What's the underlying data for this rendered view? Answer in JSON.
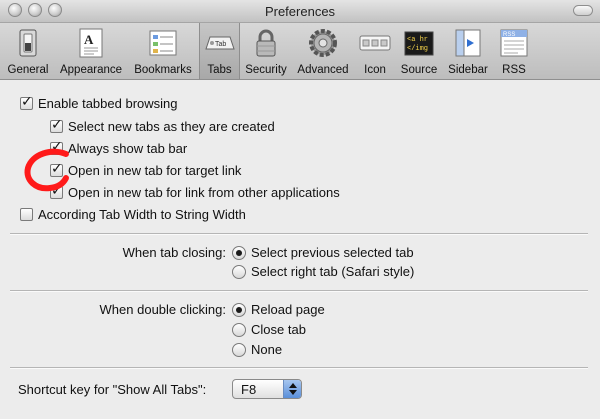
{
  "window": {
    "title": "Preferences"
  },
  "toolbar": {
    "items": [
      {
        "label": "General",
        "icon": "switch-icon"
      },
      {
        "label": "Appearance",
        "icon": "font-icon"
      },
      {
        "label": "Bookmarks",
        "icon": "bookmarks-icon"
      },
      {
        "label": "Tabs",
        "icon": "tab-icon",
        "selected": true
      },
      {
        "label": "Security",
        "icon": "lock-icon"
      },
      {
        "label": "Advanced",
        "icon": "gear-icon"
      },
      {
        "label": "Icon",
        "icon": "icon-bar-icon"
      },
      {
        "label": "Source",
        "icon": "source-icon"
      },
      {
        "label": "Sidebar",
        "icon": "sidebar-icon"
      },
      {
        "label": "RSS",
        "icon": "rss-icon"
      }
    ],
    "tab_icon_text": "Tab",
    "source_icon_text": [
      "<a hr",
      "</img"
    ],
    "rss_icon_text": "RSS"
  },
  "options": {
    "enable_tabbed": {
      "label": "Enable tabbed browsing",
      "checked": true
    },
    "select_new_tabs": {
      "label": "Select new tabs as they are created",
      "checked": true
    },
    "always_show_tab_bar": {
      "label": "Always show tab bar",
      "checked": true
    },
    "open_target_link": {
      "label": "Open in new tab for target link",
      "checked": true
    },
    "open_other_apps": {
      "label": "Open in new tab for link from other applications",
      "checked": true
    },
    "according_tab_width": {
      "label": "According Tab Width to String Width",
      "checked": false
    }
  },
  "tab_closing": {
    "label": "When tab closing:",
    "options": [
      {
        "label": "Select previous selected tab",
        "selected": true
      },
      {
        "label": "Select right tab (Safari style)",
        "selected": false
      }
    ]
  },
  "double_clicking": {
    "label": "When double clicking:",
    "options": [
      {
        "label": "Reload page",
        "selected": true
      },
      {
        "label": "Close tab",
        "selected": false
      },
      {
        "label": "None",
        "selected": false
      }
    ]
  },
  "shortcut": {
    "label": "Shortcut key for \"Show All Tabs\":",
    "value": "F8"
  },
  "colors": {
    "annotation": "#ff1a1a",
    "popup_accent": "#5a8fda"
  }
}
